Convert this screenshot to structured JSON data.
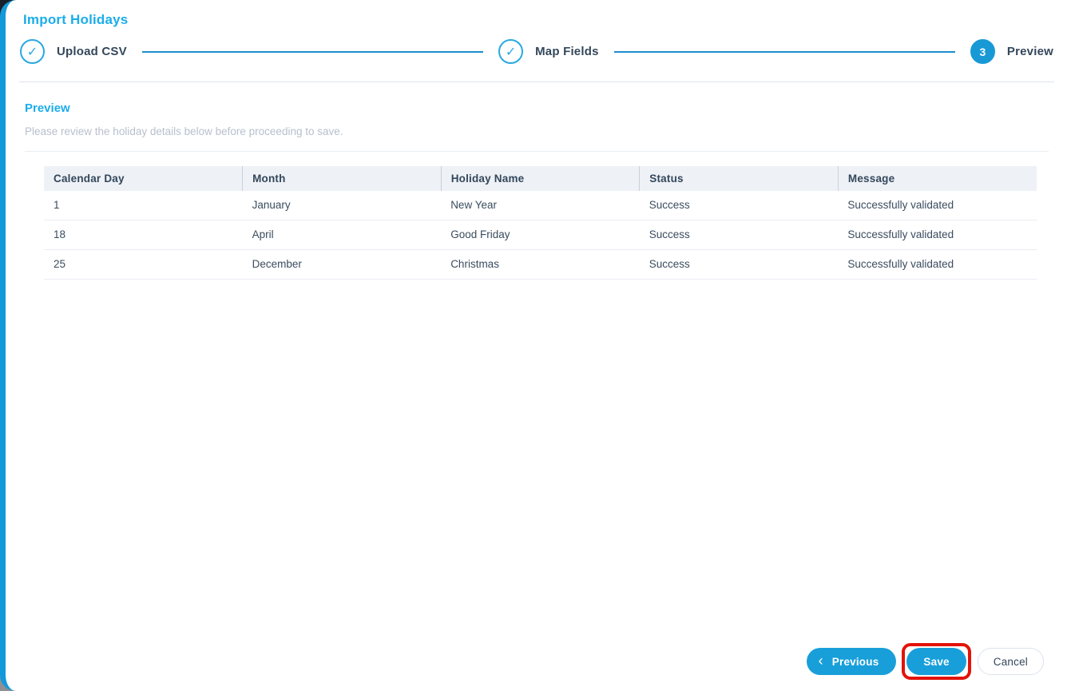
{
  "colors": {
    "accent_blue": "#189fda",
    "title_blue": "#1badea",
    "step_circle_blue": "#29a9e2",
    "text_dark_navy": "#33475b",
    "subtitle_gray": "#b7c0cd",
    "table_header_bg": "#eef1f6",
    "divider_gray": "#e9edf2",
    "annotation_red": "#e21309"
  },
  "header": {
    "title": "Import Holidays"
  },
  "stepper": {
    "steps": [
      {
        "label": "Upload CSV",
        "status": "completed",
        "icon": "✓"
      },
      {
        "label": "Map Fields",
        "status": "completed",
        "icon": "✓"
      },
      {
        "label": "Preview",
        "status": "active",
        "number": "3"
      }
    ]
  },
  "section": {
    "title": "Preview",
    "subtitle": "Please review the holiday details below before proceeding to save."
  },
  "table": {
    "columns": [
      "Calendar Day",
      "Month",
      "Holiday Name",
      "Status",
      "Message"
    ],
    "rows": [
      [
        "1",
        "January",
        "New Year",
        "Success",
        "Successfully validated"
      ],
      [
        "18",
        "April",
        "Good Friday",
        "Success",
        "Successfully validated"
      ],
      [
        "25",
        "December",
        "Christmas",
        "Success",
        "Successfully validated"
      ]
    ]
  },
  "footer": {
    "previous_label": "Previous",
    "previous_icon": "‹",
    "save_label": "Save",
    "cancel_label": "Cancel"
  }
}
